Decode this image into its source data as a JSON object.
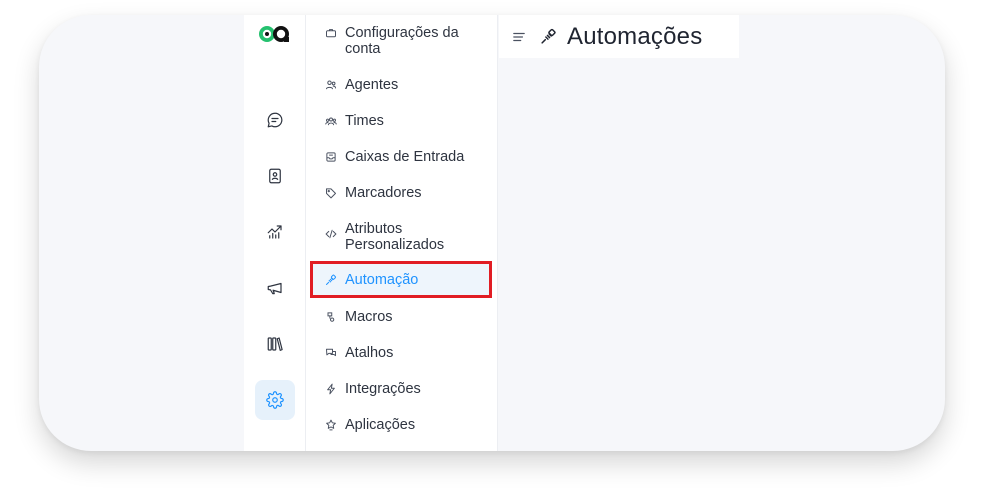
{
  "app": {
    "brand_colors": {
      "accent": "#1f93ff",
      "logo_green": "#25c16f",
      "highlight": "#e11d24"
    }
  },
  "rail": {
    "items": [
      {
        "icon": "chat-icon"
      },
      {
        "icon": "contacts-icon"
      },
      {
        "icon": "reports-icon"
      },
      {
        "icon": "campaigns-icon"
      },
      {
        "icon": "library-icon"
      },
      {
        "icon": "settings-icon",
        "active": true
      }
    ]
  },
  "settings_nav": {
    "items": [
      {
        "label": "Configurações da conta",
        "icon": "briefcase-icon"
      },
      {
        "label": "Agentes",
        "icon": "people-icon"
      },
      {
        "label": "Times",
        "icon": "team-icon"
      },
      {
        "label": "Caixas de Entrada",
        "icon": "inbox-icon"
      },
      {
        "label": "Marcadores",
        "icon": "tag-icon"
      },
      {
        "label": "Atributos Personalizados",
        "icon": "code-icon"
      },
      {
        "label": "Automação",
        "icon": "automation-icon",
        "active": true
      },
      {
        "label": "Macros",
        "icon": "macro-icon"
      },
      {
        "label": "Atalhos",
        "icon": "chat-bubbles-icon"
      },
      {
        "label": "Integrações",
        "icon": "flash-icon"
      },
      {
        "label": "Aplicações",
        "icon": "star-badge-icon"
      }
    ]
  },
  "header": {
    "title": "Automações",
    "title_icon": "automation-icon",
    "menu_icon": "hamburger-icon"
  }
}
